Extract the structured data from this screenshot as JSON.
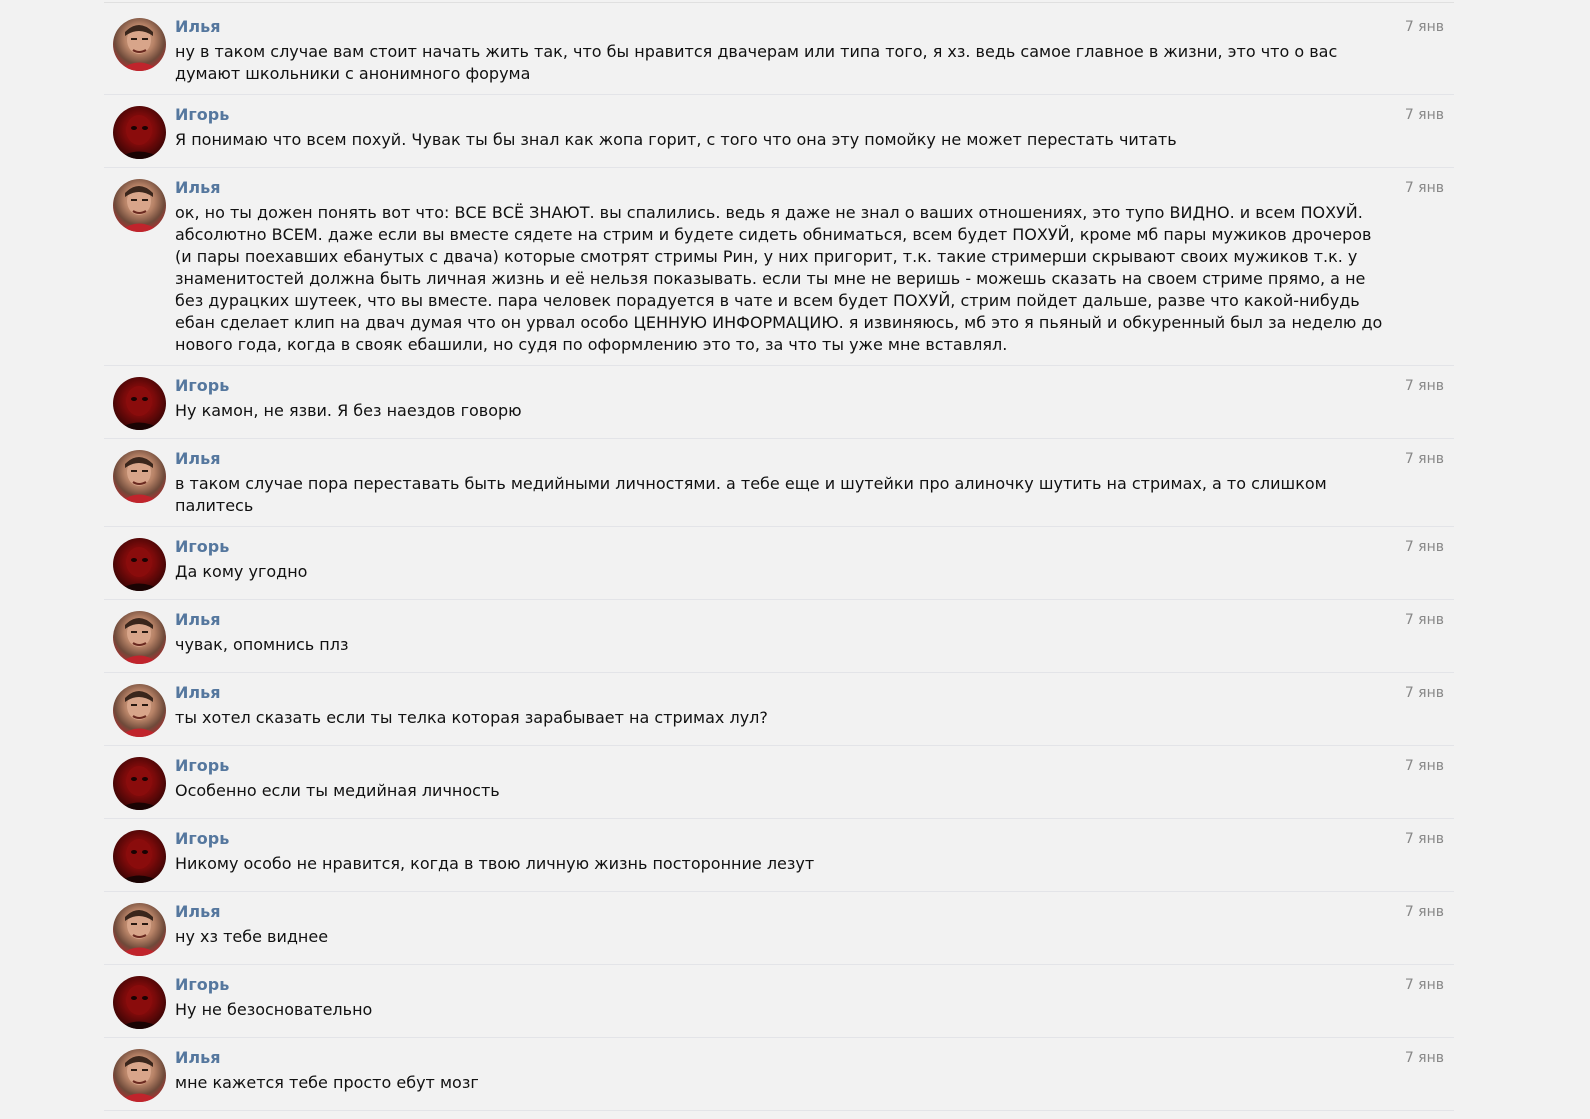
{
  "messages": [
    {
      "author": "Илья",
      "avatar": "ilya",
      "date": "7 янв",
      "text": "ну в таком случае вам стоит начать жить так, что бы нравится двачерам или типа того, я хз. ведь самое главное в жизни, это что о вас думают школьники с анонимного форума"
    },
    {
      "author": "Игорь",
      "avatar": "igor",
      "date": "7 янв",
      "text": "Я понимаю что всем похуй. Чувак ты бы знал как жопа горит, с того что она эту помойку не может перестать читать"
    },
    {
      "author": "Илья",
      "avatar": "ilya",
      "date": "7 янв",
      "text": "ок, но ты дожен понять вот что: ВСЕ ВСЁ ЗНАЮТ. вы спалились. ведь я даже не знал о ваших отношениях, это тупо ВИДНО. и всем ПОХУЙ. абсолютно ВСЕМ. даже если вы вместе сядете на стрим и будете сидеть обниматься, всем будет ПОХУЙ, кроме мб пары мужиков дрочеров (и пары поехавших ебанутых с двача) которые смотрят стримы Рин, у них пригорит, т.к. такие стримерши скрывают своих мужиков т.к. у знаменитостей должна быть личная жизнь и её нельзя показывать. если ты мне не веришь - можешь сказать на своем стриме прямо, а не без дурацких шутеек, что вы вместе. пара человек порадуется в чате и всем будет ПОХУЙ, стрим пойдет дальше, разве что какой-нибудь ебан сделает клип на двач думая что он урвал особо ЦЕННУЮ ИНФОРМАЦИЮ. я извиняюсь, мб это я пьяный и обкуренный был за неделю до нового года, когда в свояк ебашили, но судя по оформлению это то, за что ты уже мне вставлял."
    },
    {
      "author": "Игорь",
      "avatar": "igor",
      "date": "7 янв",
      "text": "Ну камон, не язви. Я без наездов говорю"
    },
    {
      "author": "Илья",
      "avatar": "ilya",
      "date": "7 янв",
      "text": "в таком случае пора переставать быть медийными личностями. а тебе еще и шутейки про алиночку шутить на стримах, а то слишком палитесь"
    },
    {
      "author": "Игорь",
      "avatar": "igor",
      "date": "7 янв",
      "text": "Да кому угодно"
    },
    {
      "author": "Илья",
      "avatar": "ilya",
      "date": "7 янв",
      "text": "чувак, опомнись плз"
    },
    {
      "author": "Илья",
      "avatar": "ilya",
      "date": "7 янв",
      "text": "ты хотел сказать если ты телка которая зарабывает на стримах лул?"
    },
    {
      "author": "Игорь",
      "avatar": "igor",
      "date": "7 янв",
      "text": "Особенно если ты медийная личность"
    },
    {
      "author": "Игорь",
      "avatar": "igor",
      "date": "7 янв",
      "text": "Никому особо не нравится, когда в твою личную жизнь посторонние лезут"
    },
    {
      "author": "Илья",
      "avatar": "ilya",
      "date": "7 янв",
      "text": "ну хз тебе виднее"
    },
    {
      "author": "Игорь",
      "avatar": "igor",
      "date": "7 янв",
      "text": "Ну не безосновательно"
    },
    {
      "author": "Илья",
      "avatar": "ilya",
      "date": "7 янв",
      "text": "мне кажется тебе просто ебут мозг"
    }
  ]
}
